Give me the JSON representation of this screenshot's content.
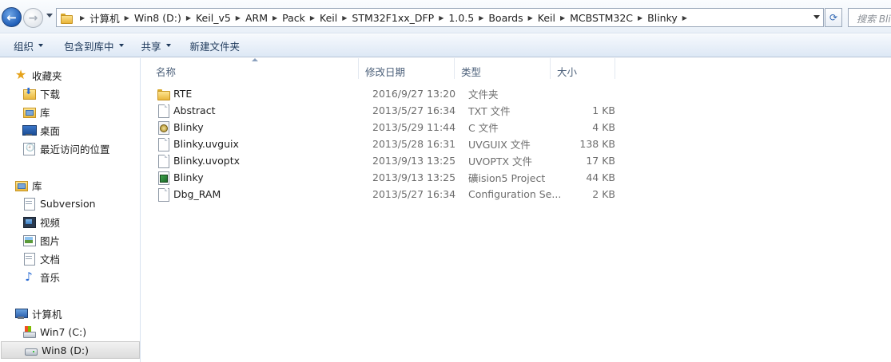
{
  "address": {
    "crumbs": [
      "计算机",
      "Win8 (D:)",
      "Keil_v5",
      "ARM",
      "Pack",
      "Keil",
      "STM32F1xx_DFP",
      "1.0.5",
      "Boards",
      "Keil",
      "MCBSTM32C",
      "Blinky"
    ],
    "search_placeholder": "搜索 Bli"
  },
  "toolbar": {
    "organize": "组织",
    "include_in_library": "包含到库中",
    "share": "共享",
    "new_folder": "新建文件夹"
  },
  "nav": {
    "favorites": "收藏夹",
    "downloads": "下载",
    "library_fav": "库",
    "desktop": "桌面",
    "recent": "最近访问的位置",
    "libraries": "库",
    "subversion": "Subversion",
    "videos": "视频",
    "pictures": "图片",
    "documents": "文档",
    "music": "音乐",
    "computer": "计算机",
    "drive_c": "Win7 (C:)",
    "drive_d": "Win8 (D:)"
  },
  "columns": {
    "name": "名称",
    "date": "修改日期",
    "type": "类型",
    "size": "大小"
  },
  "files": [
    {
      "name": "RTE",
      "date": "2016/9/27 13:20",
      "type": "文件夹",
      "size": "",
      "icon": "folder-icon"
    },
    {
      "name": "Abstract",
      "date": "2013/5/27 16:34",
      "type": "TXT 文件",
      "size": "1 KB",
      "icon": "text-file-icon"
    },
    {
      "name": "Blinky",
      "date": "2013/5/29 11:44",
      "type": "C 文件",
      "size": "4 KB",
      "icon": "c-file-icon"
    },
    {
      "name": "Blinky.uvguix",
      "date": "2013/5/28 16:31",
      "type": "UVGUIX 文件",
      "size": "138 KB",
      "icon": "file-icon"
    },
    {
      "name": "Blinky.uvoptx",
      "date": "2013/9/13 13:25",
      "type": "UVOPTX 文件",
      "size": "17 KB",
      "icon": "file-icon"
    },
    {
      "name": "Blinky",
      "date": "2013/9/13 13:25",
      "type": "礦ision5 Project",
      "size": "44 KB",
      "icon": "uvision-project-icon"
    },
    {
      "name": "Dbg_RAM",
      "date": "2013/5/27 16:34",
      "type": "Configuration Se...",
      "size": "2 KB",
      "icon": "file-icon"
    }
  ]
}
